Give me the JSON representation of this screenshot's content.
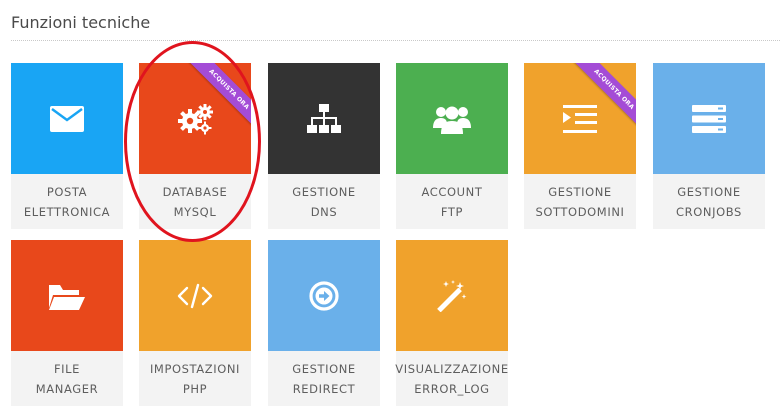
{
  "section": {
    "title": "Funzioni tecniche"
  },
  "colors": {
    "blue": "#19a5f4",
    "orange_red": "#e8481b",
    "dark": "#333333",
    "green": "#4caf50",
    "orange": "#f0a22c",
    "light_blue": "#6ab0ea",
    "ribbon_purple": "#a44cd6",
    "highlight_red": "#e0141e"
  },
  "tiles": [
    {
      "line1": "POSTA",
      "line2": "ELETTRONICA",
      "icon": "envelope-icon"
    },
    {
      "line1": "DATABASE",
      "line2": "MYSQL",
      "icon": "gears-icon",
      "ribbon": "ACQUISTA ORA"
    },
    {
      "line1": "GESTIONE",
      "line2": "DNS",
      "icon": "sitemap-icon"
    },
    {
      "line1": "ACCOUNT",
      "line2": "FTP",
      "icon": "users-icon"
    },
    {
      "line1": "GESTIONE",
      "line2": "SOTTODOMINI",
      "icon": "indent-icon",
      "ribbon": "ACQUISTA ORA"
    },
    {
      "line1": "GESTIONE",
      "line2": "CRONJOBS",
      "icon": "server-icon"
    },
    {
      "line1": "FILE",
      "line2": "MANAGER",
      "icon": "folder-open-icon"
    },
    {
      "line1": "IMPOSTAZIONI",
      "line2": "PHP",
      "icon": "code-icon"
    },
    {
      "line1": "GESTIONE",
      "line2": "REDIRECT",
      "icon": "arrow-circle-right-icon"
    },
    {
      "line1": "VISUALIZZAZIONE",
      "line2": "ERROR_LOG",
      "icon": "magic-wand-icon"
    }
  ]
}
